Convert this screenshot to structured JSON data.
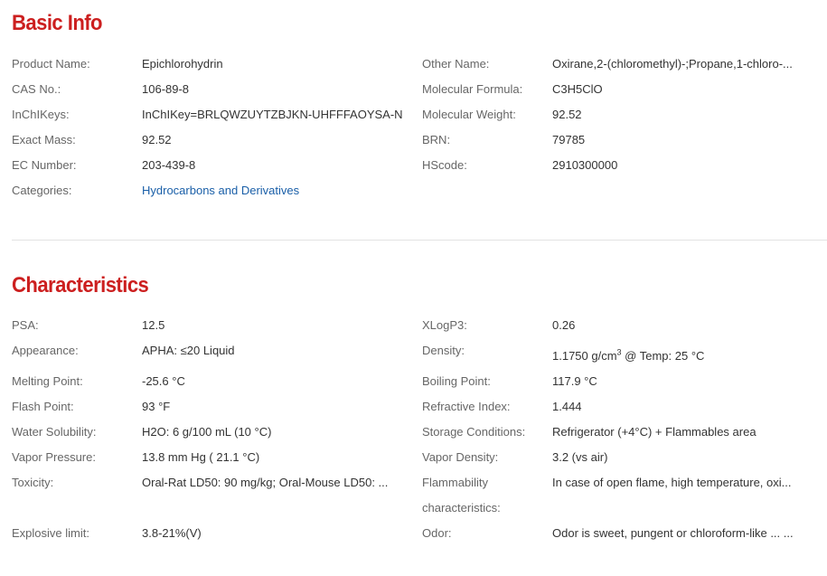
{
  "basic_info": {
    "title": "Basic Info",
    "rows": [
      {
        "label_left": "Product Name:",
        "value_left": "Epichlorohydrin",
        "label_right": "Other Name:",
        "value_right": "Oxirane,2-(chloromethyl)-;Propane,1-chloro-..."
      },
      {
        "label_left": "CAS No.:",
        "value_left": "106-89-8",
        "label_right": "Molecular Formula:",
        "value_right": "C3H5ClO"
      },
      {
        "label_left": "InChIKeys:",
        "value_left": "InChIKey=BRLQWZUYTZBJKN-UHFFFAOYSA-N",
        "label_right": "Molecular Weight:",
        "value_right": "92.52"
      },
      {
        "label_left": "Exact Mass:",
        "value_left": "92.52",
        "label_right": "BRN:",
        "value_right": "79785"
      },
      {
        "label_left": "EC Number:",
        "value_left": "203-439-8",
        "label_right": "HScode:",
        "value_right": "2910300000"
      },
      {
        "label_left": "Categories:",
        "value_left": "Hydrocarbons and Derivatives"
      }
    ]
  },
  "characteristics": {
    "title": "Characteristics",
    "rows": [
      {
        "label_left": "PSA:",
        "value_left": "12.5",
        "label_right": "XLogP3:",
        "value_right": "0.26"
      },
      {
        "label_left": "Appearance:",
        "value_left": "APHA: ≤20 Liquid",
        "label_right": "Density:",
        "value_right_pre": "1.1750 g/cm",
        "value_right_sup": "3",
        "value_right_post": " @ Temp: 25 °C"
      },
      {
        "label_left": "Melting Point:",
        "value_left": "-25.6 °C",
        "label_right": "Boiling Point:",
        "value_right": "117.9 °C"
      },
      {
        "label_left": "Flash Point:",
        "value_left": "93 °F",
        "label_right": "Refractive Index:",
        "value_right": "1.444"
      },
      {
        "label_left": "Water Solubility:",
        "value_left": "H2O: 6 g/100 mL (10 °C)",
        "label_right": "Storage Conditions:",
        "value_right": "Refrigerator (+4°C) + Flammables area"
      },
      {
        "label_left": "Vapor Pressure:",
        "value_left": "13.8 mm Hg ( 21.1 °C)",
        "label_right": "Vapor Density:",
        "value_right": "3.2 (vs air)"
      },
      {
        "label_left": "Toxicity:",
        "value_left": "Oral-Rat LD50: 90 mg/kg; Oral-Mouse LD50: ...",
        "label_right_line1": "Flammability",
        "label_right_line2": "characteristics:",
        "value_right": "In case of open flame, high temperature, oxi..."
      },
      {
        "label_left": "Explosive limit:",
        "value_left": "3.8-21%(V)",
        "label_right": "Odor:",
        "value_right": "Odor is sweet, pungent or chloroform-like ... ..."
      }
    ]
  },
  "colors": {
    "title": "#cc1f1f",
    "label": "#666666",
    "value": "#333333",
    "link": "#1a5fa8",
    "divider": "#e2e2e2"
  }
}
